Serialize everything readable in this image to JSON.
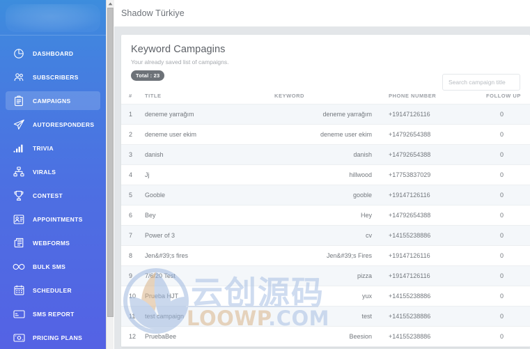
{
  "sidebar": {
    "brand": {
      "logo_name": "brand-logo-placeholder"
    },
    "items": [
      {
        "label": "DASHBOARD",
        "icon": "pie-chart-icon",
        "active": false
      },
      {
        "label": "SUBSCRIBERS",
        "icon": "users-icon",
        "active": false
      },
      {
        "label": "CAMPAIGNS",
        "icon": "clipboard-icon",
        "active": true
      },
      {
        "label": "AUTORESPONDERS",
        "icon": "paper-plane-icon",
        "active": false
      },
      {
        "label": "TRIVIA",
        "icon": "bar-chart-icon",
        "active": false
      },
      {
        "label": "VIRALS",
        "icon": "sitemap-icon",
        "active": false
      },
      {
        "label": "CONTEST",
        "icon": "trophy-icon",
        "active": false
      },
      {
        "label": "APPOINTMENTS",
        "icon": "id-card-icon",
        "active": false
      },
      {
        "label": "WEBFORMS",
        "icon": "newspaper-icon",
        "active": false
      },
      {
        "label": "BULK SMS",
        "icon": "infinity-icon",
        "active": false
      },
      {
        "label": "SCHEDULER",
        "icon": "calendar-icon",
        "active": false
      },
      {
        "label": "SMS REPORT",
        "icon": "credit-card-icon",
        "active": false
      },
      {
        "label": "PRICING PLANS",
        "icon": "money-icon",
        "active": false
      }
    ]
  },
  "topbar": {
    "title": "Shadow Türkiye"
  },
  "card": {
    "title": "Keyword Campagins",
    "subtitle": "Your already saved list of campaigns.",
    "total_badge": "Total : 23"
  },
  "search": {
    "placeholder": "Search campaign title",
    "value": ""
  },
  "table": {
    "columns": [
      "#",
      "TITLE",
      "KEYWORD",
      "PHONE NUMBER",
      "FOLLOW UP"
    ],
    "rows": [
      {
        "num": "1",
        "title": "deneme yarrağım",
        "keyword": "deneme yarrağım",
        "phone": "+19147126116",
        "follow_up": "0"
      },
      {
        "num": "2",
        "title": "deneme user ekim",
        "keyword": "deneme user ekim",
        "phone": "+14792654388",
        "follow_up": "0"
      },
      {
        "num": "3",
        "title": "danish",
        "keyword": "danish",
        "phone": "+14792654388",
        "follow_up": "0"
      },
      {
        "num": "4",
        "title": "Jj",
        "keyword": "hillwood",
        "phone": "+17753837029",
        "follow_up": "0"
      },
      {
        "num": "5",
        "title": "Gooble",
        "keyword": "gooble",
        "phone": "+19147126116",
        "follow_up": "0"
      },
      {
        "num": "6",
        "title": "Bey",
        "keyword": "Hey",
        "phone": "+14792654388",
        "follow_up": "0"
      },
      {
        "num": "7",
        "title": "Power of 3",
        "keyword": "cv",
        "phone": "+14155238886",
        "follow_up": "0"
      },
      {
        "num": "8",
        "title": "Jen&#39;s fires",
        "keyword": "Jen&#39;s Fires",
        "phone": "+19147126116",
        "follow_up": "0"
      },
      {
        "num": "9",
        "title": "7/6/20 Test",
        "keyword": "pizza",
        "phone": "+19147126116",
        "follow_up": "0"
      },
      {
        "num": "10",
        "title": "Prueba HJT",
        "keyword": "yux",
        "phone": "+14155238886",
        "follow_up": "0"
      },
      {
        "num": "11",
        "title": "test campaign",
        "keyword": "test",
        "phone": "+14155238886",
        "follow_up": "0"
      },
      {
        "num": "12",
        "title": "PruebaBee",
        "keyword": "Beesion",
        "phone": "+14155238886",
        "follow_up": "0"
      }
    ]
  },
  "watermark": {
    "cn_text": "云创源码",
    "en_text_1": "LOOWP",
    "en_text_2": ".COM"
  },
  "colors": {
    "sidebar_top": "#3d8ddd",
    "sidebar_bottom": "#5462e4",
    "page_bg": "#e3e6e9",
    "row_odd": "#f4f7fa",
    "text_muted": "#72777d",
    "badge_bg": "#6d7278"
  }
}
